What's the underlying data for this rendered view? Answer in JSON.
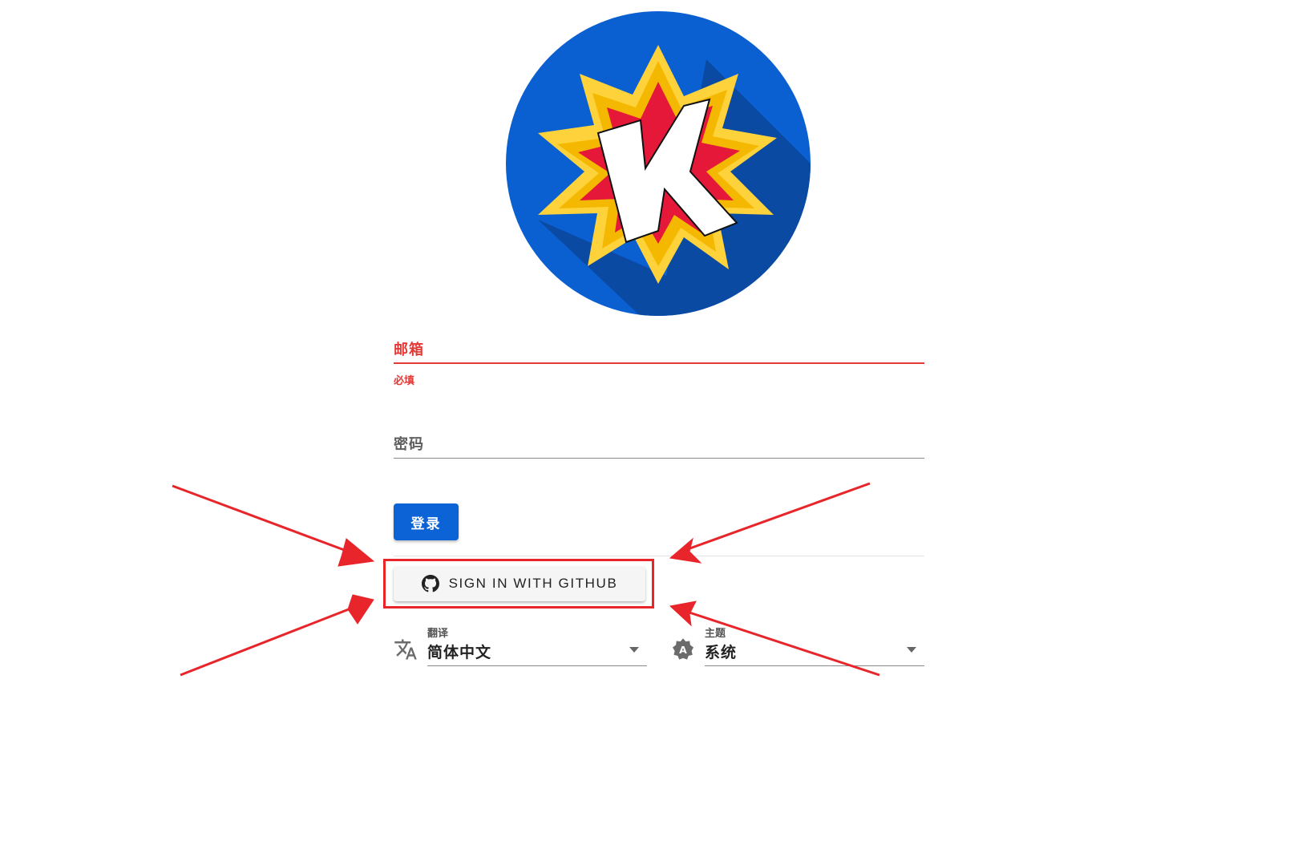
{
  "logo": {
    "icon": "k-starburst-logo",
    "letter": "K",
    "colors": {
      "circle": "#0a5fd1",
      "shadow": "#0a4aa3",
      "outer_burst": "#fdd23a",
      "mid_burst": "#f5b800",
      "inner_burst": "#e5183a",
      "letter_fill": "#ffffff"
    }
  },
  "form": {
    "email": {
      "label": "邮箱",
      "hint": "必填",
      "state": "error",
      "error_color": "#e53935",
      "value": ""
    },
    "password": {
      "label": "密码",
      "value": ""
    },
    "login_button": {
      "label": "登录",
      "color": "#0b63d6"
    },
    "github_button": {
      "label": "SIGN IN WITH GITHUB",
      "icon": "github-icon"
    }
  },
  "settings": {
    "language": {
      "label": "翻译",
      "value": "简体中文",
      "icon": "translate-icon"
    },
    "theme": {
      "label": "主题",
      "value": "系统",
      "icon": "theme-auto-icon"
    }
  },
  "annotations": {
    "highlight_color": "#e8252a",
    "arrow_count": 4
  }
}
